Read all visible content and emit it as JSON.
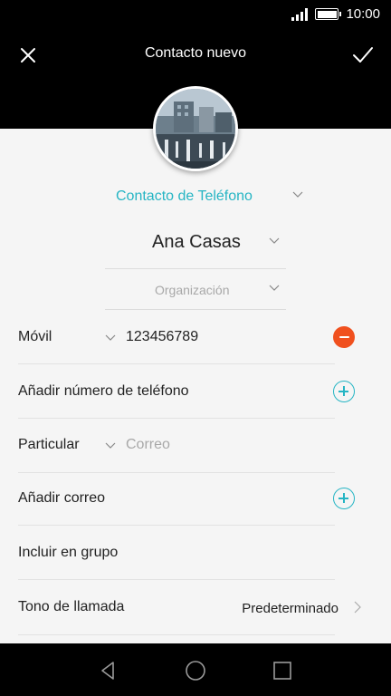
{
  "status_bar": {
    "time": "10:00",
    "icons": [
      "signal-icon",
      "battery-icon"
    ]
  },
  "header": {
    "title": "Contacto nuevo",
    "close_icon": "close-icon",
    "save_icon": "check-icon",
    "background": "#000000"
  },
  "account": {
    "label": "Contacto de Teléfono",
    "color": "#26b5c4"
  },
  "name": {
    "value": "Ana Casas"
  },
  "organization": {
    "placeholder": "Organización"
  },
  "phone": {
    "type": "Móvil",
    "value": "123456789",
    "action_icon": "remove-icon"
  },
  "add_phone": {
    "label": "Añadir número de teléfono",
    "action_icon": "add-icon"
  },
  "email": {
    "type": "Particular",
    "placeholder": "Correo"
  },
  "add_email": {
    "label": "Añadir correo",
    "action_icon": "add-icon"
  },
  "group": {
    "label": "Incluir en grupo"
  },
  "ringtone": {
    "label": "Tono de llamada",
    "value": "Predeterminado"
  },
  "nav": {
    "icons": [
      "back-icon",
      "home-icon",
      "recents-icon"
    ]
  },
  "colors": {
    "accent": "#26b5c4",
    "remove": "#f0501e"
  }
}
